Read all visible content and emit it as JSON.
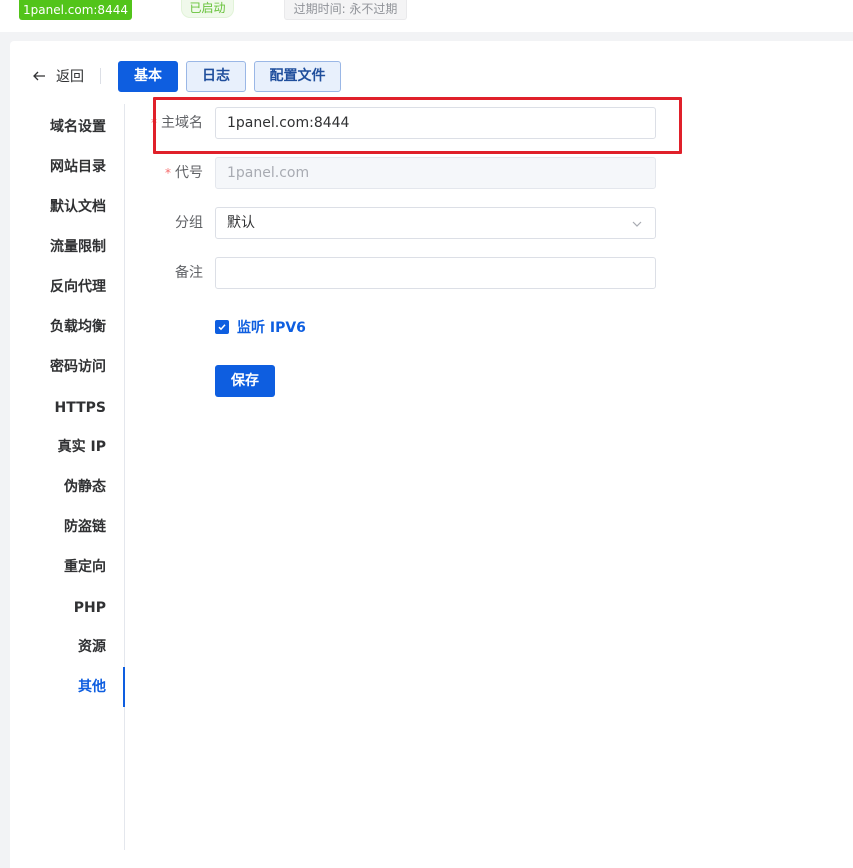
{
  "header": {
    "site_name": "1panel.com:8444",
    "status": "已启动",
    "expire": "过期时间: 永不过期"
  },
  "nav": {
    "back_label": "返回",
    "tabs": [
      {
        "label": "基本",
        "active": true
      },
      {
        "label": "日志",
        "active": false
      },
      {
        "label": "配置文件",
        "active": false
      }
    ]
  },
  "sidebar": {
    "items": [
      {
        "label": "域名设置"
      },
      {
        "label": "网站目录"
      },
      {
        "label": "默认文档"
      },
      {
        "label": "流量限制"
      },
      {
        "label": "反向代理"
      },
      {
        "label": "负载均衡"
      },
      {
        "label": "密码访问"
      },
      {
        "label": "HTTPS"
      },
      {
        "label": "真实 IP"
      },
      {
        "label": "伪静态"
      },
      {
        "label": "防盗链"
      },
      {
        "label": "重定向"
      },
      {
        "label": "PHP"
      },
      {
        "label": "资源"
      },
      {
        "label": "其他",
        "active": true
      }
    ]
  },
  "form": {
    "primary_domain": {
      "label": "主域名",
      "value": "1panel.com:8444",
      "required": true
    },
    "alias": {
      "label": "代号",
      "value": "1panel.com",
      "required": true,
      "disabled": true
    },
    "group": {
      "label": "分组",
      "value": "默认"
    },
    "remark": {
      "label": "备注",
      "value": ""
    },
    "ipv6": {
      "label": "监听 IPV6",
      "checked": true
    },
    "save_label": "保存"
  },
  "colors": {
    "primary": "#0e5ee0",
    "success": "#52c41a",
    "highlight": "#e0202a"
  }
}
